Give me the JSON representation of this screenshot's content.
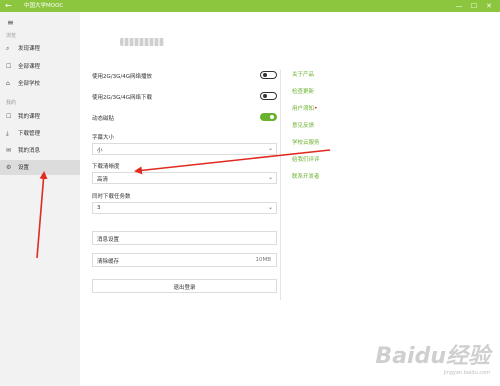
{
  "titlebar": {
    "back_icon": "←",
    "title": "中国大学MOOC",
    "minimize": "—",
    "maximize": "☐",
    "close": "✕",
    "color": "#8cc63f"
  },
  "sidebar": {
    "menu_icon": "≡",
    "section_browse": "浏览",
    "browse_items": [
      {
        "icon": "⌕",
        "label": "发现课程"
      },
      {
        "icon": "☐",
        "label": "全部课程"
      },
      {
        "icon": "⌂",
        "label": "全部学校"
      }
    ],
    "section_mine": "我的",
    "mine_items": [
      {
        "icon": "☐",
        "label": "我的课程"
      },
      {
        "icon": "⤓",
        "label": "下载管理"
      },
      {
        "icon": "✉",
        "label": "我的消息"
      },
      {
        "icon": "⚙",
        "label": "设置"
      }
    ]
  },
  "settings": {
    "toggles": [
      {
        "label": "使用2G/3G/4G网络播放",
        "on": false
      },
      {
        "label": "使用2G/3G/4G网络下载",
        "on": false
      },
      {
        "label": "动态磁贴",
        "on": true
      }
    ],
    "font_size": {
      "label": "字幕大小",
      "value": "小"
    },
    "download_quality": {
      "label": "下载清晰度",
      "value": "高清"
    },
    "concurrent_downloads": {
      "label": "同时下载任务数",
      "value": "3"
    },
    "message_settings": "消息设置",
    "clear_cache": {
      "label": "清除缓存",
      "size": "10MB"
    },
    "logout": "退出登录",
    "chevron": "⌄"
  },
  "links": [
    {
      "label": "关于产品",
      "dot": false
    },
    {
      "label": "检查更新",
      "dot": false
    },
    {
      "label": "用户须知",
      "dot": true
    },
    {
      "label": "意见反馈",
      "dot": false
    },
    {
      "label": "学校云服务",
      "dot": false
    },
    {
      "label": "给我们评评",
      "dot": false
    },
    {
      "label": "联系开发者",
      "dot": false
    }
  ],
  "watermark": {
    "text": "Baidu经验",
    "sub": "jingyan.baidu.com"
  },
  "accent": "#6ab12e",
  "annotation_color": "#e02b20"
}
